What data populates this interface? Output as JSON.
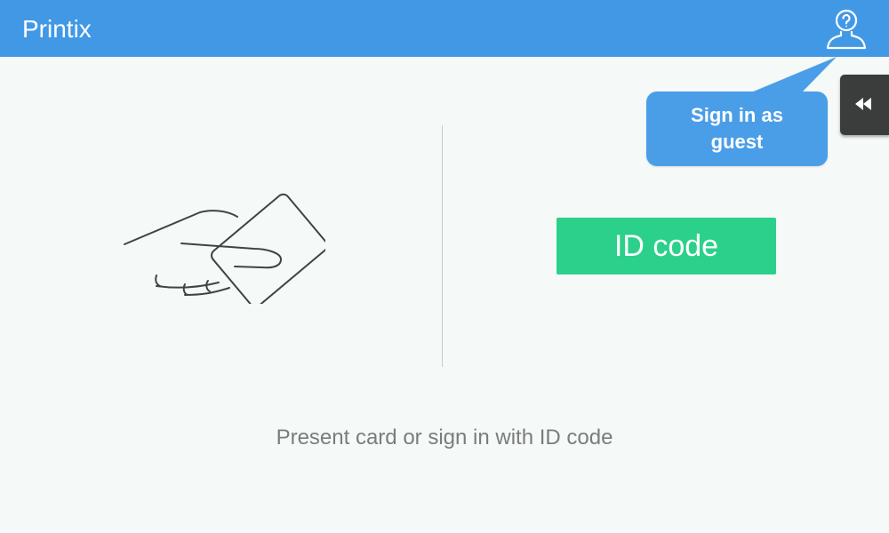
{
  "header": {
    "title": "Printix",
    "guest_icon": "user-question-icon"
  },
  "tooltip": {
    "text": "Sign in as guest"
  },
  "side_tab": {
    "icon": "rewind-icon"
  },
  "main": {
    "card_icon": "hand-card-icon",
    "id_button_label": "ID code",
    "instruction": "Present card or sign in with ID code"
  },
  "colors": {
    "header": "#4199e6",
    "tooltip": "#4a9ee8",
    "id_button": "#2bd18a",
    "side_tab": "#3a3d3c",
    "background": "#f5f9f7"
  }
}
